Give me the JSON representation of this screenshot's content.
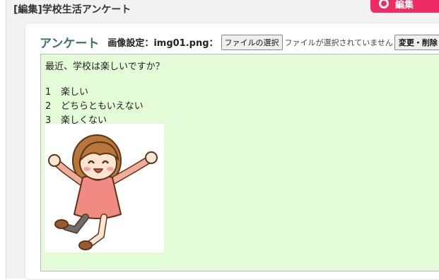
{
  "header": {
    "title": "[編集]学校生活アンケート",
    "top_button_label": "編集"
  },
  "card": {
    "section_title": "アンケート",
    "image_setting_label": "画像設定：img01.png：",
    "file_button_label": "ファイルの選択",
    "no_file_text": "ファイルが選択されていません",
    "change_button_label": "変更・削除"
  },
  "preview": {
    "question": "最近、学校は楽しいですか？",
    "options": [
      {
        "num": "1",
        "label": "楽しい"
      },
      {
        "num": "2",
        "label": "どちらともいえない"
      },
      {
        "num": "3",
        "label": "楽しくない"
      }
    ]
  },
  "colors": {
    "accent_pink": "#ef2b63",
    "title_teal": "#3f6f72",
    "preview_bg": "#e3fbd6"
  }
}
